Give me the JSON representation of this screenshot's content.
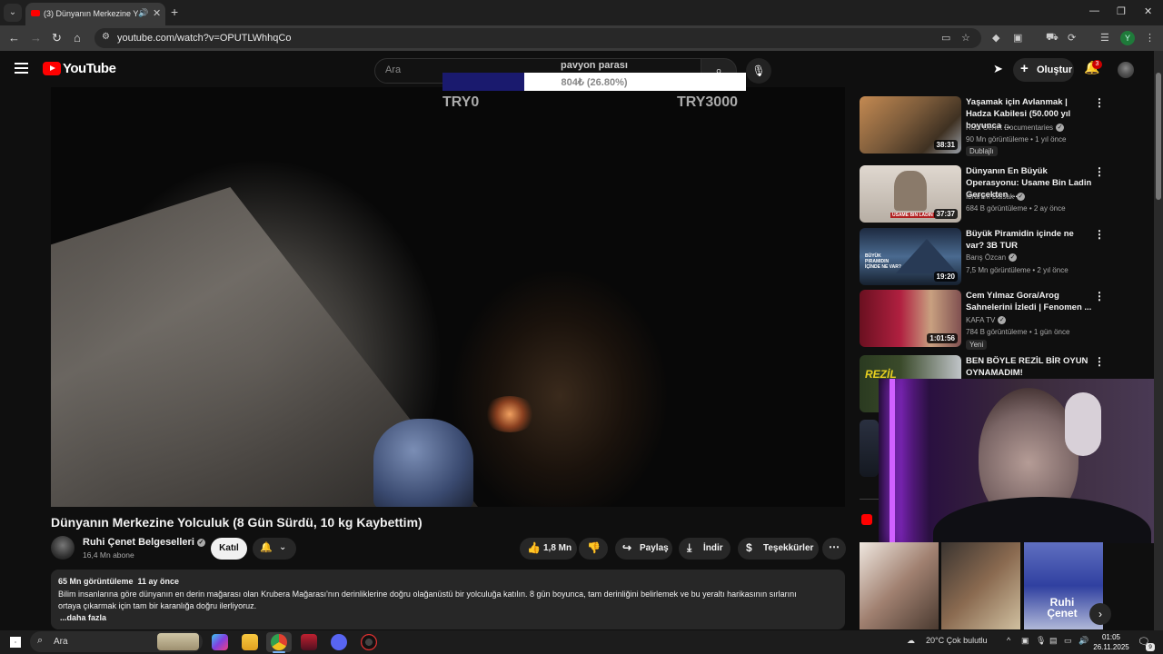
{
  "browser": {
    "tab_title": "(3) Dünyanın Merkezine Yo",
    "url": "youtube.com/watch?v=OPUTLWhhqCo"
  },
  "header": {
    "logo_text": "YouTube",
    "search_placeholder": "Ara",
    "create_label": "Oluştur",
    "notification_count": "3"
  },
  "donation": {
    "title": "pavyon parası",
    "progress_text": "804₺ (26.80%)",
    "progress_fraction": 0.268,
    "min_label": "TRY0",
    "max_label": "TRY3000",
    "fill_color": "#1a1a6e"
  },
  "video": {
    "title": "Dünyanın Merkezine Yolculuk (8 Gün Sürdü, 10 kg Kaybettim)",
    "channel": "Ruhi Çenet Belgeselleri",
    "subscribers": "16,4 Mn abone",
    "join_label": "Katıl",
    "likes": "1,8 Mn",
    "share_label": "Paylaş",
    "download_label": "İndir",
    "thanks_label": "Teşekkürler",
    "views": "65 Mn görüntüleme",
    "date": "11 ay önce",
    "description_line1": "Bilim insanlarına göre dünyanın en derin mağarası olan Krubera Mağarası'nın derinliklerine doğru olağanüstü bir yolculuğa katılın. 8 gün boyunca, tam derinliğini belirlemek ve bu yeraltı harikasının sırlarını",
    "description_line2": "ortaya çıkarmak için tam bir karanlığa doğru ilerliyoruz.",
    "more_label": "...daha fazla"
  },
  "related": [
    {
      "title": "Yaşamak için Avlanmak | Hadza Kabilesi (50.000 yıl boyunca ...",
      "channel": "Ruhi Cenet Documentaries",
      "meta": "90 Mn görüntüleme • 1 yıl önce",
      "duration": "38:31",
      "badge": "Dublajlı"
    },
    {
      "title": "Dünyanın En Büyük Operasyonu: Usame Bin Ladin Gerçekten ...",
      "channel": "İbrahim Balsak",
      "meta": "684 B görüntüleme • 2 ay önce",
      "duration": "37:37",
      "thumb_text": "USAME BIN LADIN"
    },
    {
      "title": "Büyük Piramidin içinde ne var? 3B TUR",
      "channel": "Barış Özcan",
      "meta": "7,5 Mn görüntüleme • 2 yıl önce",
      "duration": "19:20",
      "thumb_text": "BÜYÜK PIRAMIDIN İÇİNDE NE VAR?"
    },
    {
      "title": "Cem Yılmaz Gora/Arog Sahnelerini İzledi | Fenomen ...",
      "channel": "KAFA TV",
      "meta": "784 B görüntüleme • 1 gün önce",
      "duration": "1:01:56",
      "badge": "Yeni"
    },
    {
      "title": "BEN BÖYLE REZİL BİR OYUN OYNAMADIM!",
      "thumb_text": "REZİL"
    }
  ],
  "shorts_thumb_text": "Ruhi Çenet",
  "taskbar": {
    "search_label": "Ara",
    "weather": "20°C  Çok bulutlu",
    "time": "01:05",
    "date": "26.11.2025",
    "notif_count": "9"
  }
}
